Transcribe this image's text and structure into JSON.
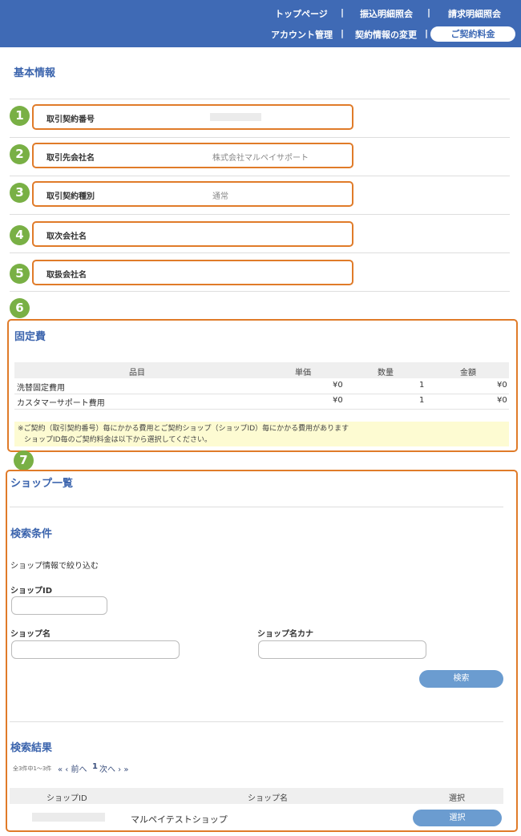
{
  "header": {
    "nav_top": [
      "トップページ",
      "振込明細照会",
      "請求明細照会"
    ],
    "nav_bottom": [
      "アカウント管理",
      "契約情報の変更"
    ],
    "active": "ご契約料金",
    "separator": "|"
  },
  "basic": {
    "title": "基本情報",
    "fields": [
      {
        "num": "1",
        "label": "取引契約番号",
        "value": ""
      },
      {
        "num": "2",
        "label": "取引先会社名",
        "value": "株式会社マルペイサポート"
      },
      {
        "num": "3",
        "label": "取引契約種別",
        "value": "通常"
      },
      {
        "num": "4",
        "label": "取次会社名",
        "value": ""
      },
      {
        "num": "5",
        "label": "取扱会社名",
        "value": ""
      }
    ]
  },
  "fixed": {
    "num": "6",
    "title": "固定費",
    "headers": [
      "品目",
      "単価",
      "数量",
      "金額"
    ],
    "rows": [
      [
        "洗替固定費用",
        "¥0",
        "1",
        "¥0"
      ],
      [
        "カスタマーサポート費用",
        "¥0",
        "1",
        "¥0"
      ]
    ],
    "note_line1": "※ご契約（取引契約番号）毎にかかる費用とご契約ショップ（ショップID）毎にかかる費用があります",
    "note_line2": "ショップID毎のご契約料金は以下から選択してください。"
  },
  "shops": {
    "num": "7",
    "title": "ショップ一覧",
    "search_title": "検索条件",
    "filter_label": "ショップ情報で絞り込む",
    "shop_id_label": "ショップID",
    "shop_name_label": "ショップ名",
    "shop_kana_label": "ショップ名カナ",
    "search_button": "検索",
    "result_title": "検索結果",
    "result_count": "全3件中1～3件",
    "pager": "« ‹ 前へ",
    "pager_page": "1",
    "pager_next": "次へ › »",
    "headers": [
      "ショップID",
      "ショップ名",
      "選択"
    ],
    "rows": [
      {
        "id": "",
        "name": "マルペイテストショップ",
        "button": "選択"
      }
    ]
  },
  "colors": {
    "header": "#3f6ab5",
    "accent": "#e07b29",
    "badge": "#79b045",
    "button": "#6b9cd0"
  }
}
